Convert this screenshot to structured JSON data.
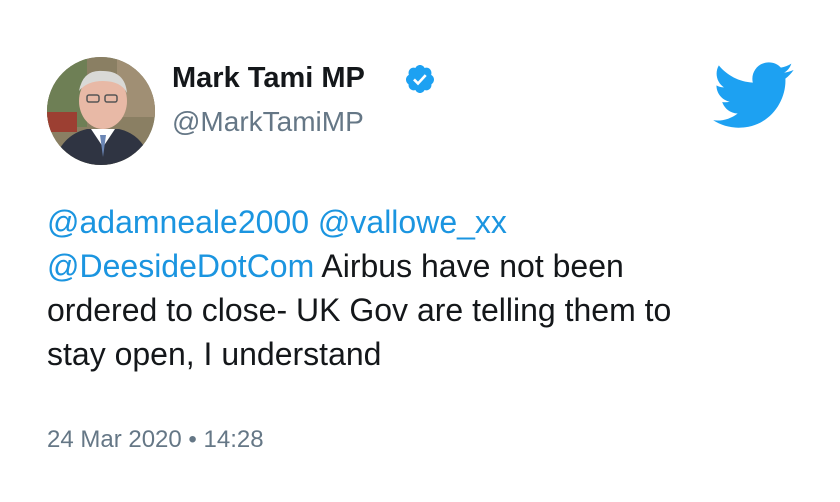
{
  "author": {
    "name": "Mark Tami MP",
    "handle": "@MarkTamiMP",
    "verified": true,
    "avatar_icon": "profile-photo"
  },
  "tweet": {
    "mentions": [
      "@adamneale2000",
      "@vallowe_xx",
      "@DeesideDotCom"
    ],
    "line1_sep": " ",
    "body_line3_start": " Airbus have not been",
    "body_line4": "ordered to close- UK Gov are telling them to",
    "body_line5": "stay open, I understand",
    "timestamp": "24 Mar 2020 • 14:28"
  },
  "brand": {
    "logo_icon": "twitter-bird-icon",
    "accent_color": "#1da1f2",
    "mention_color": "#1b95e0",
    "muted_color": "#657786"
  }
}
